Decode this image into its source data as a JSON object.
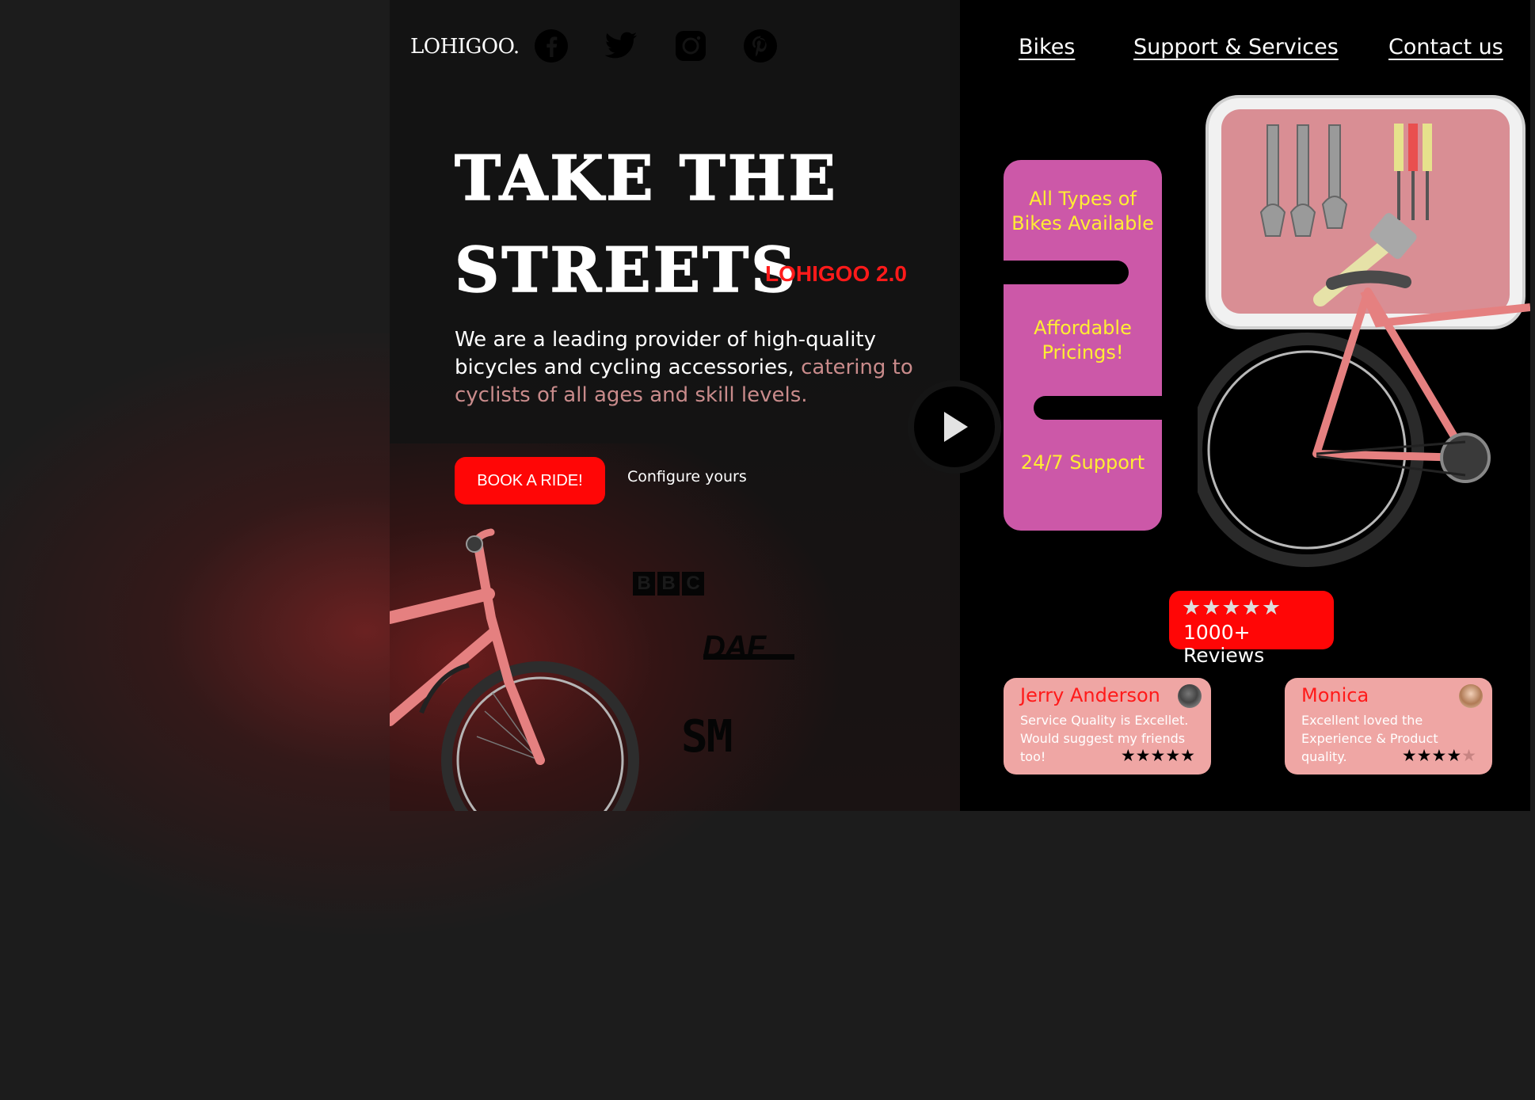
{
  "brand": {
    "name": "LOHIGOO."
  },
  "social": [
    "facebook-icon",
    "twitter-icon",
    "instagram-icon",
    "pinterest-icon"
  ],
  "nav": {
    "bikes": "Bikes",
    "support": "Support & Services",
    "contact": "Contact us"
  },
  "hero": {
    "title_line1": "TAKE THE",
    "title_line2": "STREETS",
    "tag": "LOHIGOO 2.0",
    "desc_main": "We are a leading provider of high-quality bicycles and cycling accessories,",
    "desc_accent": "catering to cyclists of all ages and skill levels.",
    "book_label": "BOOK A RIDE!",
    "configure_label": "Configure yours"
  },
  "partners": {
    "bbc": [
      "B",
      "B",
      "C"
    ],
    "daf": "DAF",
    "sm": "SM"
  },
  "features": {
    "one": "All Types of Bikes Available",
    "two": "Affordable Pricings!",
    "three": "24/7 Support"
  },
  "reviews": {
    "badge_stars": "★★★★★",
    "badge_label": "1000+ Reviews",
    "cards": [
      {
        "name": "Jerry Anderson",
        "text": "Service Quality is Excellet. Would suggest my friends too!",
        "rating": 5,
        "stars": "★★★★★",
        "empty_stars": ""
      },
      {
        "name": "Monica",
        "text": "Excellent loved the Experience & Product quality.",
        "rating": 4,
        "stars": "★★★★",
        "empty_stars": "★"
      }
    ]
  },
  "colors": {
    "accent_red": "#ff0606",
    "feature_pink": "#cc58a8",
    "feature_text": "#ffee33",
    "card_pink": "#efa6a4",
    "bike_pink": "#e58080"
  }
}
